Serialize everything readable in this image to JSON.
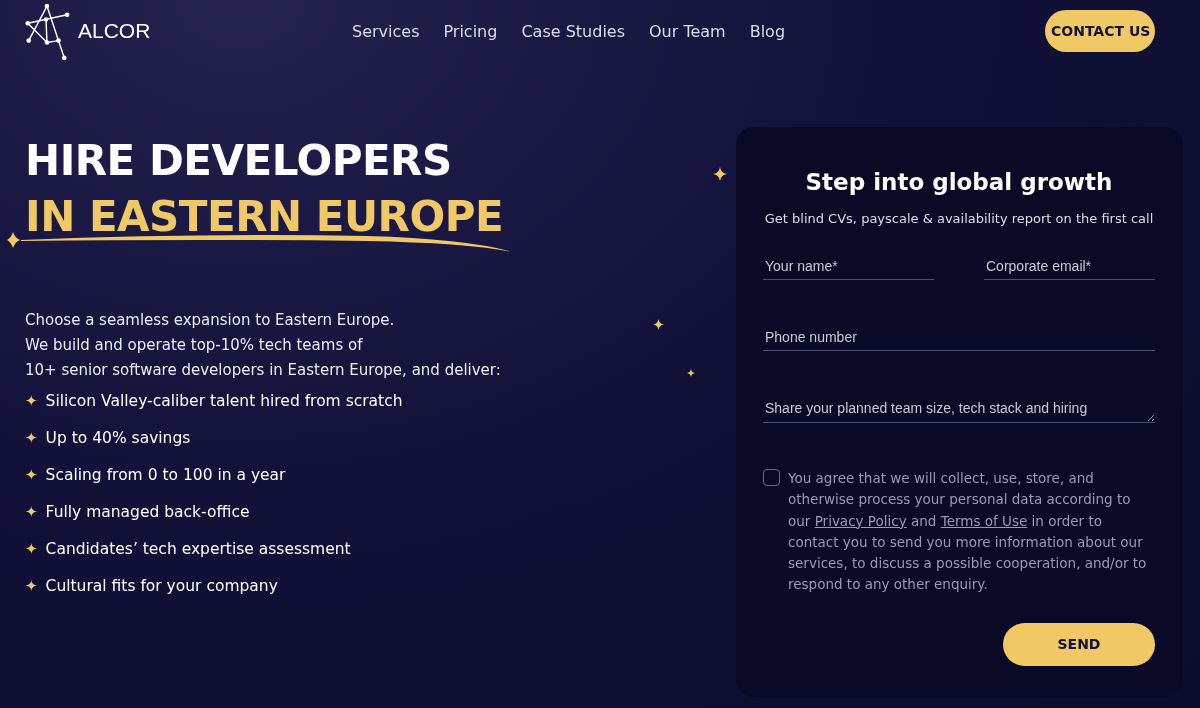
{
  "header": {
    "logo_text": "ALCOR",
    "nav": [
      {
        "label": "Services"
      },
      {
        "label": "Pricing"
      },
      {
        "label": "Case Studies"
      },
      {
        "label": "Our Team"
      },
      {
        "label": "Blog"
      }
    ],
    "cta": "CONTACT US"
  },
  "hero": {
    "title_line_1": "HIRE DEVELOPERS",
    "title_line_2": "IN EASTERN EUROPE",
    "intro": [
      "Choose a seamless expansion to Eastern Europe.",
      "We build and operate top-10% tech teams of",
      "10+ senior software developers in Eastern Europe, and deliver:"
    ],
    "bullet": "✦",
    "features": [
      "Silicon Valley-caliber talent hired from scratch",
      "Up to 40% savings",
      "Scaling from 0 to 100 in a year",
      "Fully managed back-office",
      "Candidates’ tech expertise assessment",
      "Cultural fits for your company"
    ]
  },
  "form": {
    "title": "Step into global growth",
    "subtitle": "Get blind CVs, payscale & availability report on the first call",
    "fields": [
      {
        "placeholder": "Your name*"
      },
      {
        "placeholder": "Corporate email*"
      },
      {
        "placeholder": "Phone number"
      },
      {
        "placeholder": "Share your planned team size, tech stack and hiring"
      }
    ],
    "consent": {
      "checked": false,
      "text_before": "You agree that we will collect, use, store, and otherwise process your personal data according to our",
      "link_1": "Privacy Policy",
      "text_between": "and",
      "link_2": "Terms of Use",
      "text_after": "in order to contact you to send you more information about our services, to discuss a possible cooperation, and/or to respond to any other enquiry."
    },
    "submit": "SEND"
  }
}
